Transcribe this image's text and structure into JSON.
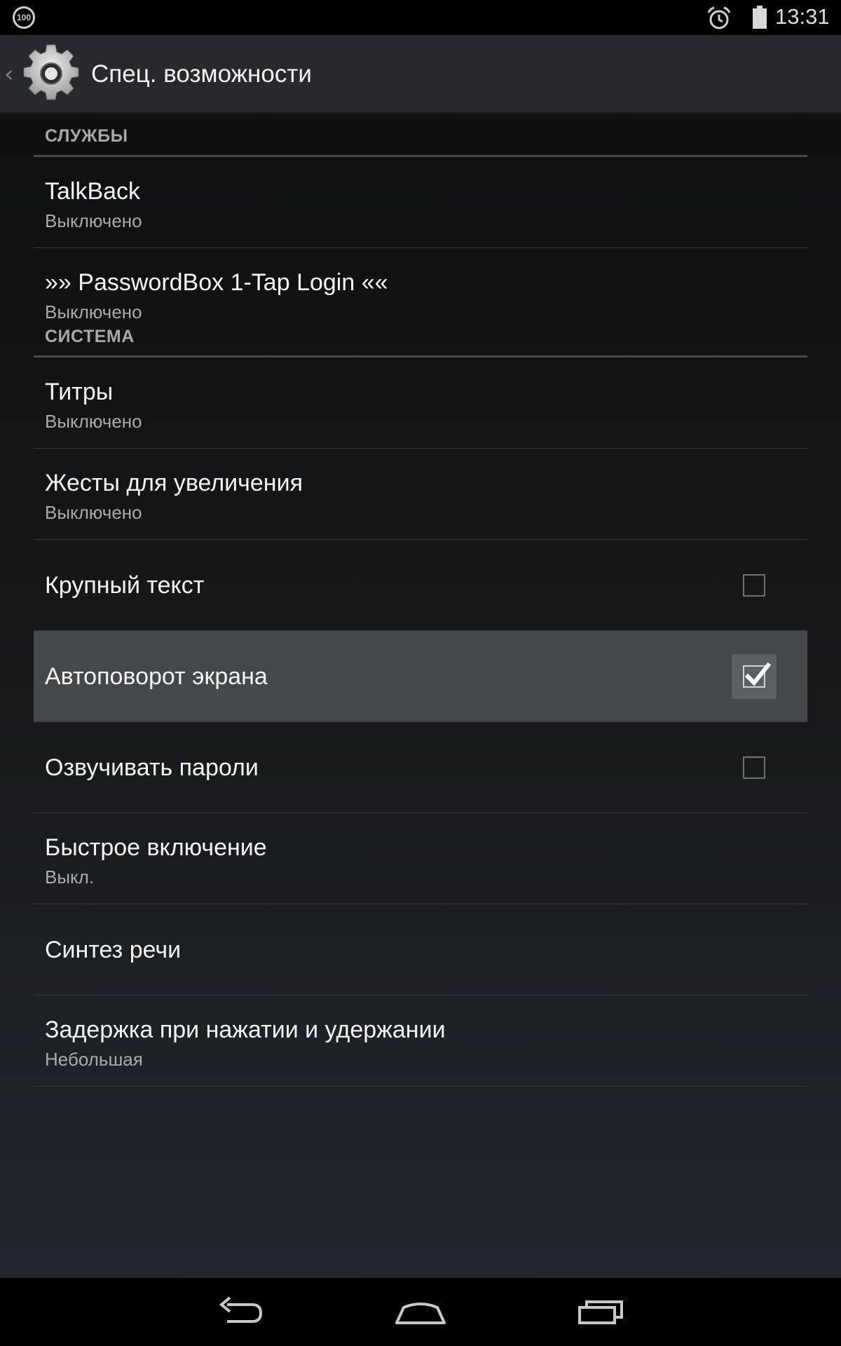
{
  "status_bar": {
    "left_badge": "100",
    "time": "13:31",
    "icons": [
      "alarm-icon",
      "battery-icon"
    ]
  },
  "action_bar": {
    "back_glyph": "‹",
    "title": "Спец. возможности",
    "icon": "gear-icon"
  },
  "sections": [
    {
      "header": "СЛУЖБЫ",
      "items": [
        {
          "title": "TalkBack",
          "summary": "Выключено"
        },
        {
          "title": "»» PasswordBox 1-Tap Login ««",
          "summary": "Выключено"
        }
      ]
    },
    {
      "header": "СИСТЕМА",
      "items": [
        {
          "title": "Титры",
          "summary": "Выключено"
        },
        {
          "title": "Жесты для увеличения",
          "summary": "Выключено"
        },
        {
          "title": "Крупный текст",
          "checked": false
        },
        {
          "title": "Автоповорот экрана",
          "checked": true
        },
        {
          "title": "Озвучивать пароли",
          "checked": false
        },
        {
          "title": "Быстрое включение",
          "summary": "Выкл."
        },
        {
          "title": "Синтез речи"
        },
        {
          "title": "Задержка при нажатии и удержании",
          "summary": "Небольшая"
        }
      ]
    }
  ],
  "nav_bar": {
    "buttons": [
      "back-icon",
      "home-icon",
      "recents-icon"
    ]
  },
  "colors": {
    "highlight": "#43484c",
    "section_header_text": "#a5a9ac",
    "summary_text": "#a8acaf"
  }
}
